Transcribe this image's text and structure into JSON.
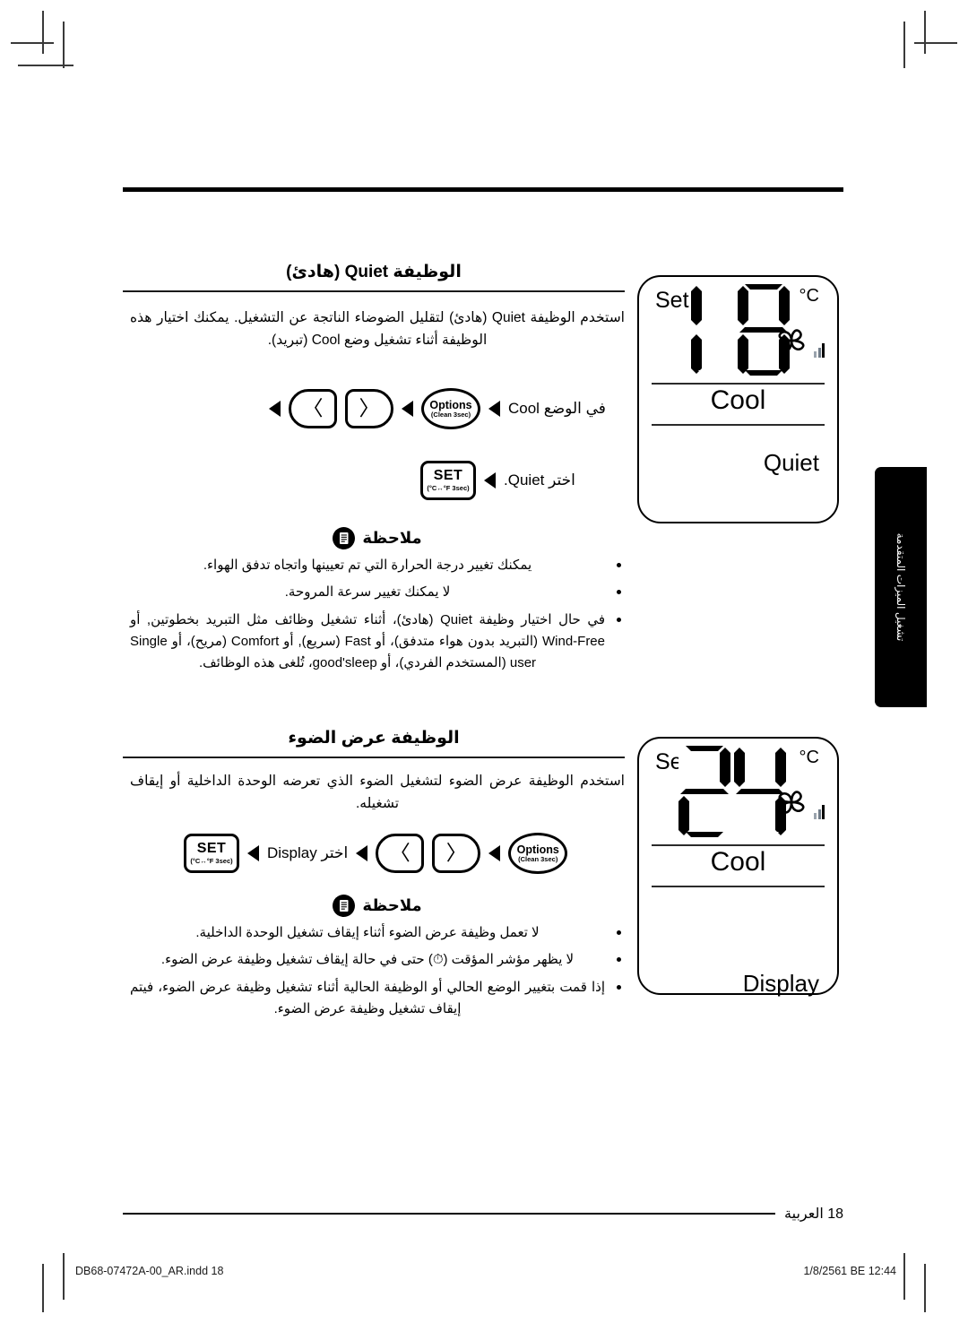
{
  "document": {
    "language": "ar",
    "page_number_label": "18 العربية",
    "side_tab_text": "تشغيل الميزات المتقدمة",
    "print_footer_left": "DB68-07472A-00_AR.indd   18",
    "print_footer_right": "1/8/2561 BE   12:44"
  },
  "sections": [
    {
      "title": "الوظيفة Quiet (هادئ)",
      "body": "استخدم الوظيفة Quiet (هادئ) لتقليل الضوضاء الناتجة عن التشغيل. يمكنك اختيار هذه الوظيفة أثناء تشغيل وضع Cool (تبريد).",
      "steps": [
        {
          "label": "في الوضع Cool",
          "buttons": [
            "options-button",
            "nav-right-button",
            "nav-left-button"
          ],
          "trailing_arrow": true
        },
        {
          "label": "اختر Quiet.",
          "buttons": [
            "set-button"
          ],
          "trailing_arrow": false
        }
      ],
      "note": {
        "label": "ملاحظة",
        "items": [
          "يمكنك تغيير درجة الحرارة التي تم تعيينها واتجاه تدفق الهواء.",
          "لا يمكنك تغيير سرعة المروحة.",
          "في حال اختيار وظيفة Quiet (هادئ)، أثناء تشغيل وظائف مثل التبريد بخطوتين, أو Wind-Free (التبريد بدون هواء متدفق)، أو Fast (سريع), أو Comfort (مريح)، أو Single user (المستخدم الفردي)، أو good'sleep، تُلغى هذه الوظائف."
        ]
      },
      "display": {
        "set_label": "Set",
        "temperature": "18",
        "unit": "°C",
        "mode": "Cool",
        "bottom_label": "Quiet"
      }
    },
    {
      "title": "الوظيفة عرض الضوء",
      "body": "استخدم الوظيفة عرض الضوء لتشغيل الضوء الذي تعرضه الوحدة الداخلية أو إيقاف تشغيله.",
      "steps": [
        {
          "label": "اختر Display",
          "buttons": [
            "options-button",
            "nav-right-button",
            "nav-left-button",
            "set-button"
          ],
          "trailing_arrow": true
        }
      ],
      "note": {
        "label": "ملاحظة",
        "items": [
          "لا تعمل وظيفة عرض الضوء أثناء إيقاف تشغيل الوحدة الداخلية.",
          "لا يظهر مؤشر المؤقت (⏱) حتى في حالة إيقاف تشغيل وظيفة عرض الضوء.",
          "إذا قمت بتغيير الوضع الحالي أو الوظيفة الحالية أثناء تشغيل وظيفة عرض الضوء، فيتم إيقاف تشغيل وظيفة عرض الضوء."
        ]
      },
      "display": {
        "set_label": "Set",
        "temperature": "24",
        "unit": "°C",
        "mode": "Cool",
        "bottom_label": "Display"
      }
    }
  ],
  "buttons": {
    "options": {
      "line1": "Options",
      "line2": "(Clean 3sec)"
    },
    "set": {
      "line1": "SET",
      "line2": "(°C↔°F 3sec)"
    },
    "nav_left_glyph": "〈",
    "nav_right_glyph": "〉"
  },
  "colors": {
    "ink": "#000000",
    "paper": "#ffffff",
    "tab": "#000000",
    "bar_light": "#9aa3ad",
    "bar_mid": "#6f7b87"
  }
}
